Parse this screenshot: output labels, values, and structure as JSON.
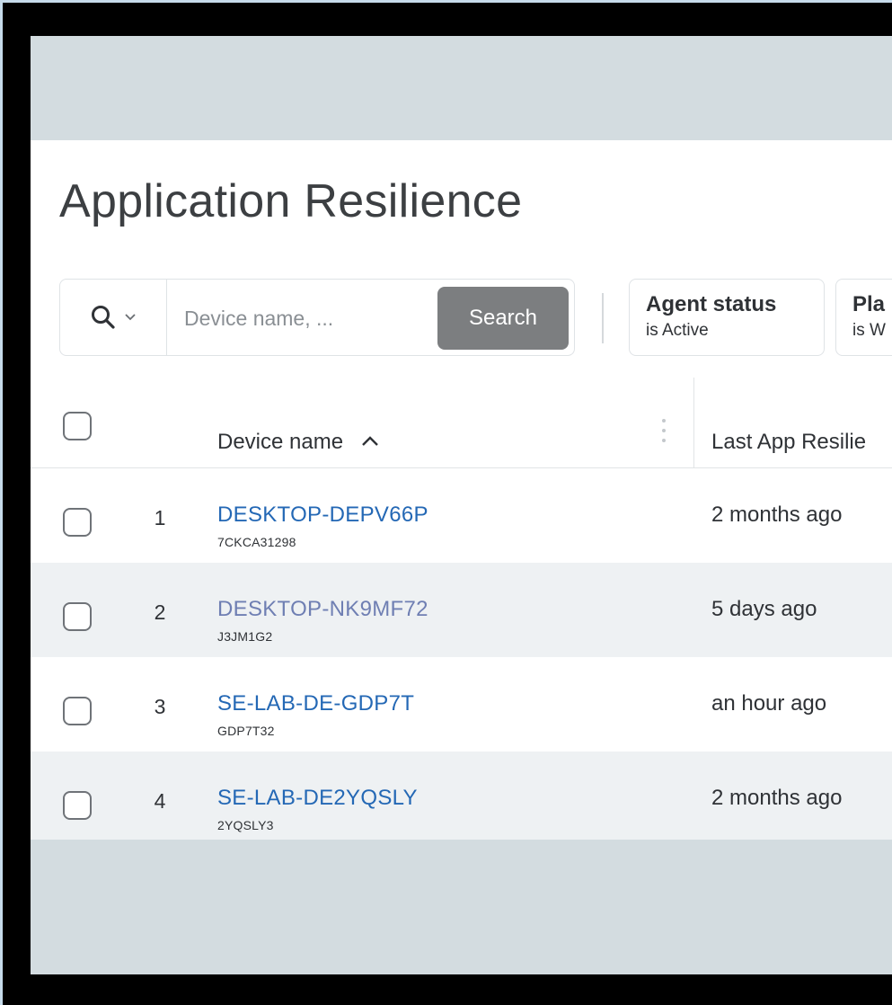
{
  "page": {
    "title": "Application Resilience"
  },
  "search": {
    "scope_icon": "search-icon",
    "placeholder": "Device name, ...",
    "button_label": "Search"
  },
  "filters": [
    {
      "title": "Agent status",
      "value": "is Active"
    },
    {
      "title": "Pla",
      "value": "is W"
    }
  ],
  "table": {
    "columns": {
      "device_name": "Device name",
      "last_check": "Last App Resilie"
    },
    "sort": "ascending",
    "rows": [
      {
        "index": "1",
        "device": "DESKTOP-DEPV66P",
        "serial": "7CKCA31298",
        "last_check": "2 months ago",
        "visited": false
      },
      {
        "index": "2",
        "device": "DESKTOP-NK9MF72",
        "serial": "J3JM1G2",
        "last_check": "5 days ago",
        "visited": true
      },
      {
        "index": "3",
        "device": "SE-LAB-DE-GDP7T",
        "serial": "GDP7T32",
        "last_check": "an hour ago",
        "visited": false
      },
      {
        "index": "4",
        "device": "SE-LAB-DE2YQSLY",
        "serial": "2YQSLY3",
        "last_check": "2 months ago",
        "visited": false
      }
    ]
  },
  "colors": {
    "link": "#2468b5",
    "link_visited": "#6f7fb3",
    "search_button": "#7c7e80",
    "alt_row": "#eef1f3",
    "backdrop": "#d3dce0"
  }
}
